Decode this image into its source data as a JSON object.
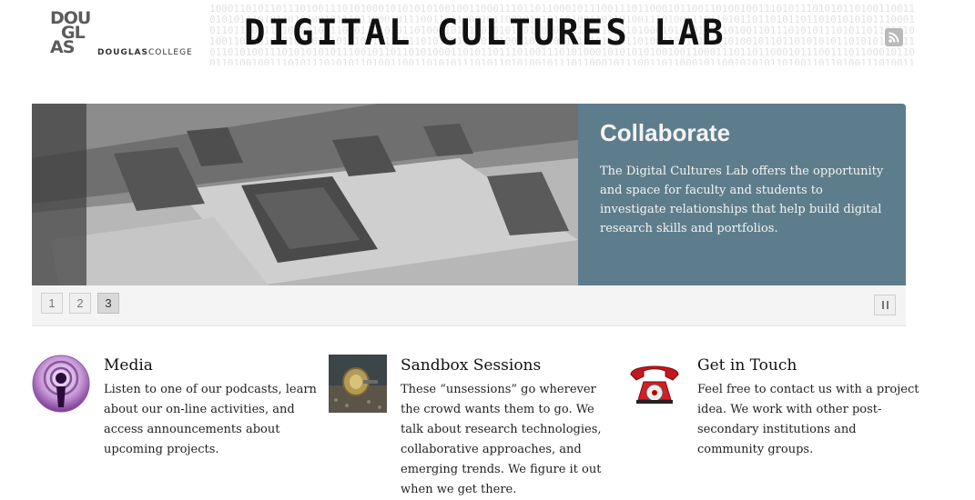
{
  "header": {
    "binary_text": "1000110101101110100111010100010101010100100110001110110110001011100111011000101100110100100111010111010101101001100110101011101011010100101110110001011100110110001011001010101101001101101001110100111011010110110101101101010101011100010110111011101000010111000110101011010001010100101011010010101110110101010001010101101101001101110101011101011011011101001101001010101101010101011010101101011010100101001101110010101011101101001101101011101001011011010101011010101010110110101001110101010101110010110110101000110101101110100111010100010101010100100110001110110110001011100111011000101100110100100111010111010101101001100110101011101011010100101110110001011100110110001011001010101101001101101001110100111011010110110101101101010101011100010110111011101000010111000110101011010001010100101011010010101110110101010001010101101101001101110101011101011011011101001101001010101101",
    "logo_mark": [
      "DOU",
      "GL",
      "AS"
    ],
    "logo_text_bold": "DOUGLAS",
    "logo_text": "COLLEGE",
    "title": "DIGITAL CULTURES LAB",
    "rss_icon": "rss-feed-icon"
  },
  "slider": {
    "image_subject": "computer-lab-desks",
    "caption_title": "Collaborate",
    "caption_text": "The Digital Cultures Lab offers the opportunity and space for faculty and students to investigate relationships that help build digital research skills and portfolios.",
    "pager": [
      "1",
      "2",
      "3"
    ],
    "active_page": "3",
    "caption_bg": "#5e7d8c"
  },
  "features": [
    {
      "icon": "podcast-icon",
      "title": "Media",
      "text": "Listen to one of our podcasts, learn about our on-line activities, and access announcements about upcoming projects."
    },
    {
      "icon": "sandbox-thumbnail",
      "title": "Sandbox Sessions",
      "text": "These “unsessions” go wherever the crowd wants them to go. We talk about research technologies, collaborative approaches, and emerging trends. We figure it out when we get there."
    },
    {
      "icon": "red-telephone-icon",
      "title": "Get in Touch",
      "text": "Feel free to contact us with a project idea. We work with other post-secondary institutions and community groups."
    }
  ]
}
